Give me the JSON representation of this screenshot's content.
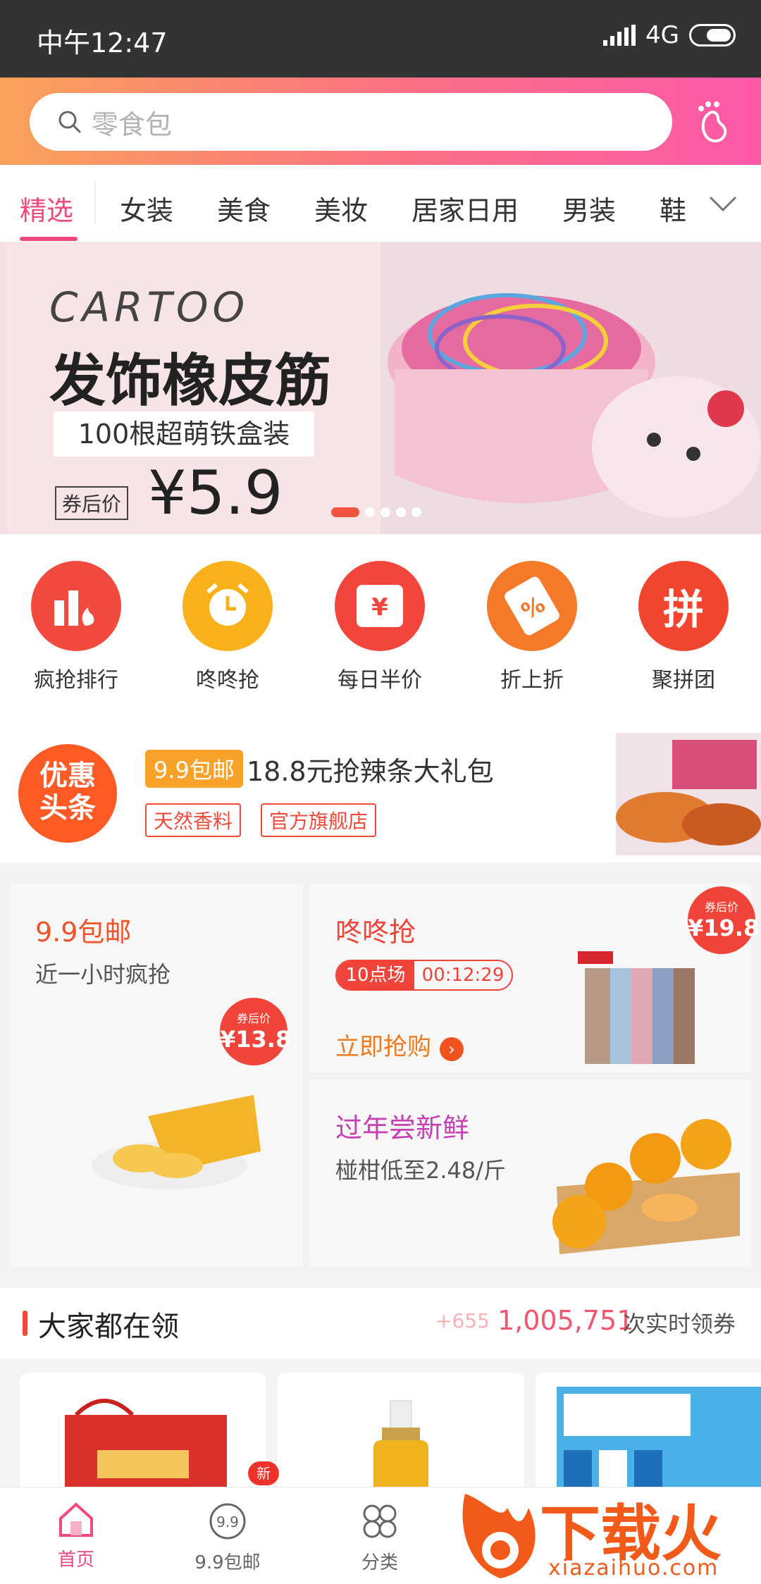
{
  "status_bar": {
    "time": "中午12:47",
    "network": "4G"
  },
  "search": {
    "placeholder": "零食包"
  },
  "categories": {
    "items": [
      "精选",
      "女装",
      "美食",
      "美妆",
      "居家日用",
      "男装",
      "鞋"
    ],
    "active_index": 0
  },
  "banner": {
    "brand": "CARTOO",
    "title": "发饰橡皮筋",
    "subtitle": "100根超萌铁盒装",
    "price_tag": "券后价",
    "price": "¥5.9",
    "slides": 5,
    "active_slide": 0
  },
  "quick_entries": [
    {
      "label": "疯抢排行",
      "icon": "bar-chart-fire-icon",
      "color": "#f24a3e"
    },
    {
      "label": "咚咚抢",
      "icon": "alarm-clock-icon",
      "color": "#f9b11b"
    },
    {
      "label": "每日半价",
      "icon": "calendar-yen-icon",
      "color": "#f2453c",
      "glyph": "¥"
    },
    {
      "label": "折上折",
      "icon": "price-tag-percent-icon",
      "color": "#f47a2a",
      "glyph": "%"
    },
    {
      "label": "聚拼团",
      "icon": "pin-group-icon",
      "color": "#f2452f",
      "glyph": "拼"
    }
  ],
  "headline": {
    "badge": "优惠头条",
    "badge_line1": "优惠",
    "badge_line2": "头条",
    "pill": "9.9包邮",
    "title": "18.8元抢辣条大礼包",
    "tags": [
      "天然香料",
      "官方旗舰店"
    ]
  },
  "promo": {
    "left": {
      "title": "9.9包邮",
      "subtitle": "近一小时疯抢",
      "coupon_label": "券后价",
      "coupon_price": "¥13.8",
      "title_color": "#f0532a"
    },
    "flash": {
      "title": "咚咚抢",
      "session": "10点场",
      "countdown": "00:12:29",
      "cta": "立即抢购",
      "coupon_label": "券后价",
      "coupon_price": "¥19.8",
      "title_color": "#f0433a"
    },
    "fresh": {
      "title": "过年尝新鲜",
      "subtitle": "椪柑低至2.48/斤",
      "title_color": "#c640b4"
    }
  },
  "leading": {
    "title": "大家都在领",
    "increment": "+655",
    "count": "1,005,751",
    "suffix": "次实时领券"
  },
  "tabbar": {
    "items": [
      {
        "label": "首页"
      },
      {
        "label": "9.9包邮"
      },
      {
        "label": "分类"
      }
    ],
    "active_index": 0,
    "badge": "新"
  },
  "watermark": {
    "text": "下载火",
    "url": "xiazaihuo.com"
  }
}
